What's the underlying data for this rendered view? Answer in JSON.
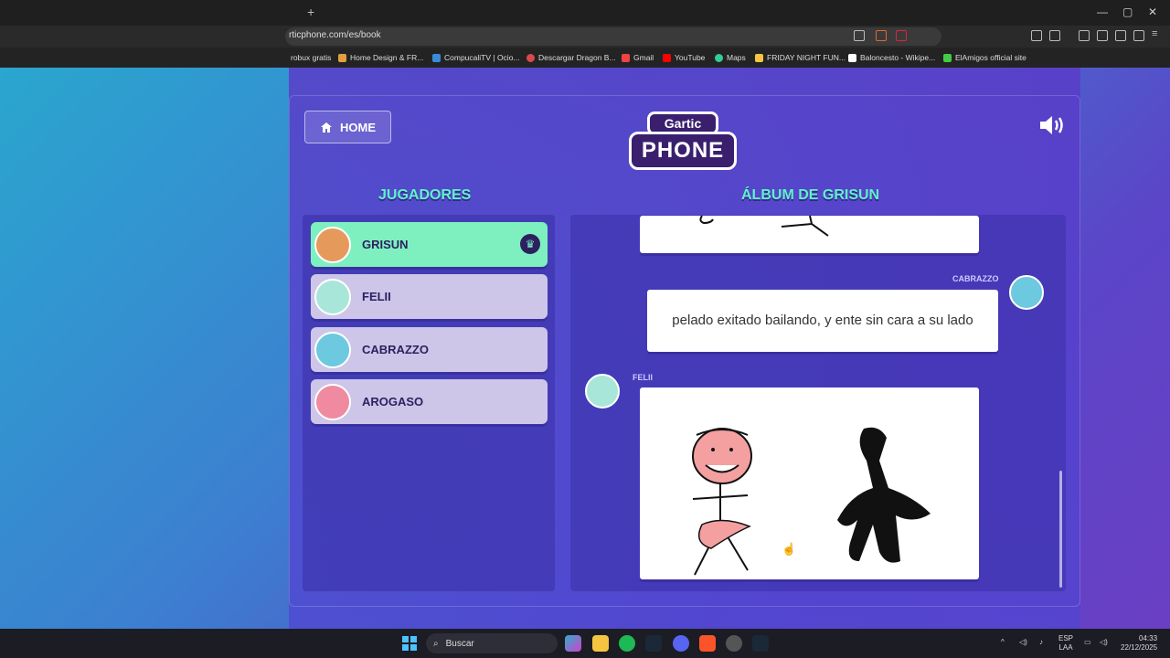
{
  "browser": {
    "url": "rticphone.com/es/book",
    "new_tab": "+",
    "bookmarks": [
      "robux gratis",
      "Home Design & FR...",
      "CompucaliTV | Ocio...",
      "Descargar Dragon B...",
      "Gmail",
      "YouTube",
      "Maps",
      "FRIDAY NIGHT FUN...",
      "Baloncesto - Wikipe...",
      "ElAmigos official site"
    ]
  },
  "header": {
    "home_label": "HOME",
    "logo_top": "Gartic",
    "logo_bottom": "PHONE"
  },
  "players": {
    "title": "JUGADORES",
    "list": [
      {
        "name": "GRISUN",
        "active": true,
        "color": "#e59a5c"
      },
      {
        "name": "FELII",
        "active": false,
        "color": "#a8e6d9"
      },
      {
        "name": "CABRAZZO",
        "active": false,
        "color": "#6cc9e0"
      },
      {
        "name": "AROGASO",
        "active": false,
        "color": "#f08aa0"
      }
    ]
  },
  "album": {
    "title": "ÁLBUM DE GRISUN",
    "entry_caption_speaker": "CABRAZZO",
    "entry_caption_text": "pelado exitado bailando, y ente sin cara a su lado",
    "entry_drawing_speaker": "FELII"
  },
  "taskbar": {
    "search_label": "Buscar",
    "lang_top": "ESP",
    "lang_bottom": "LAA",
    "time": "04:33",
    "date": "22/12/2025"
  },
  "colors": {
    "accent_green": "#5ef3c8",
    "active_player": "#7ef0c0",
    "dark_purple": "#2d2060"
  }
}
